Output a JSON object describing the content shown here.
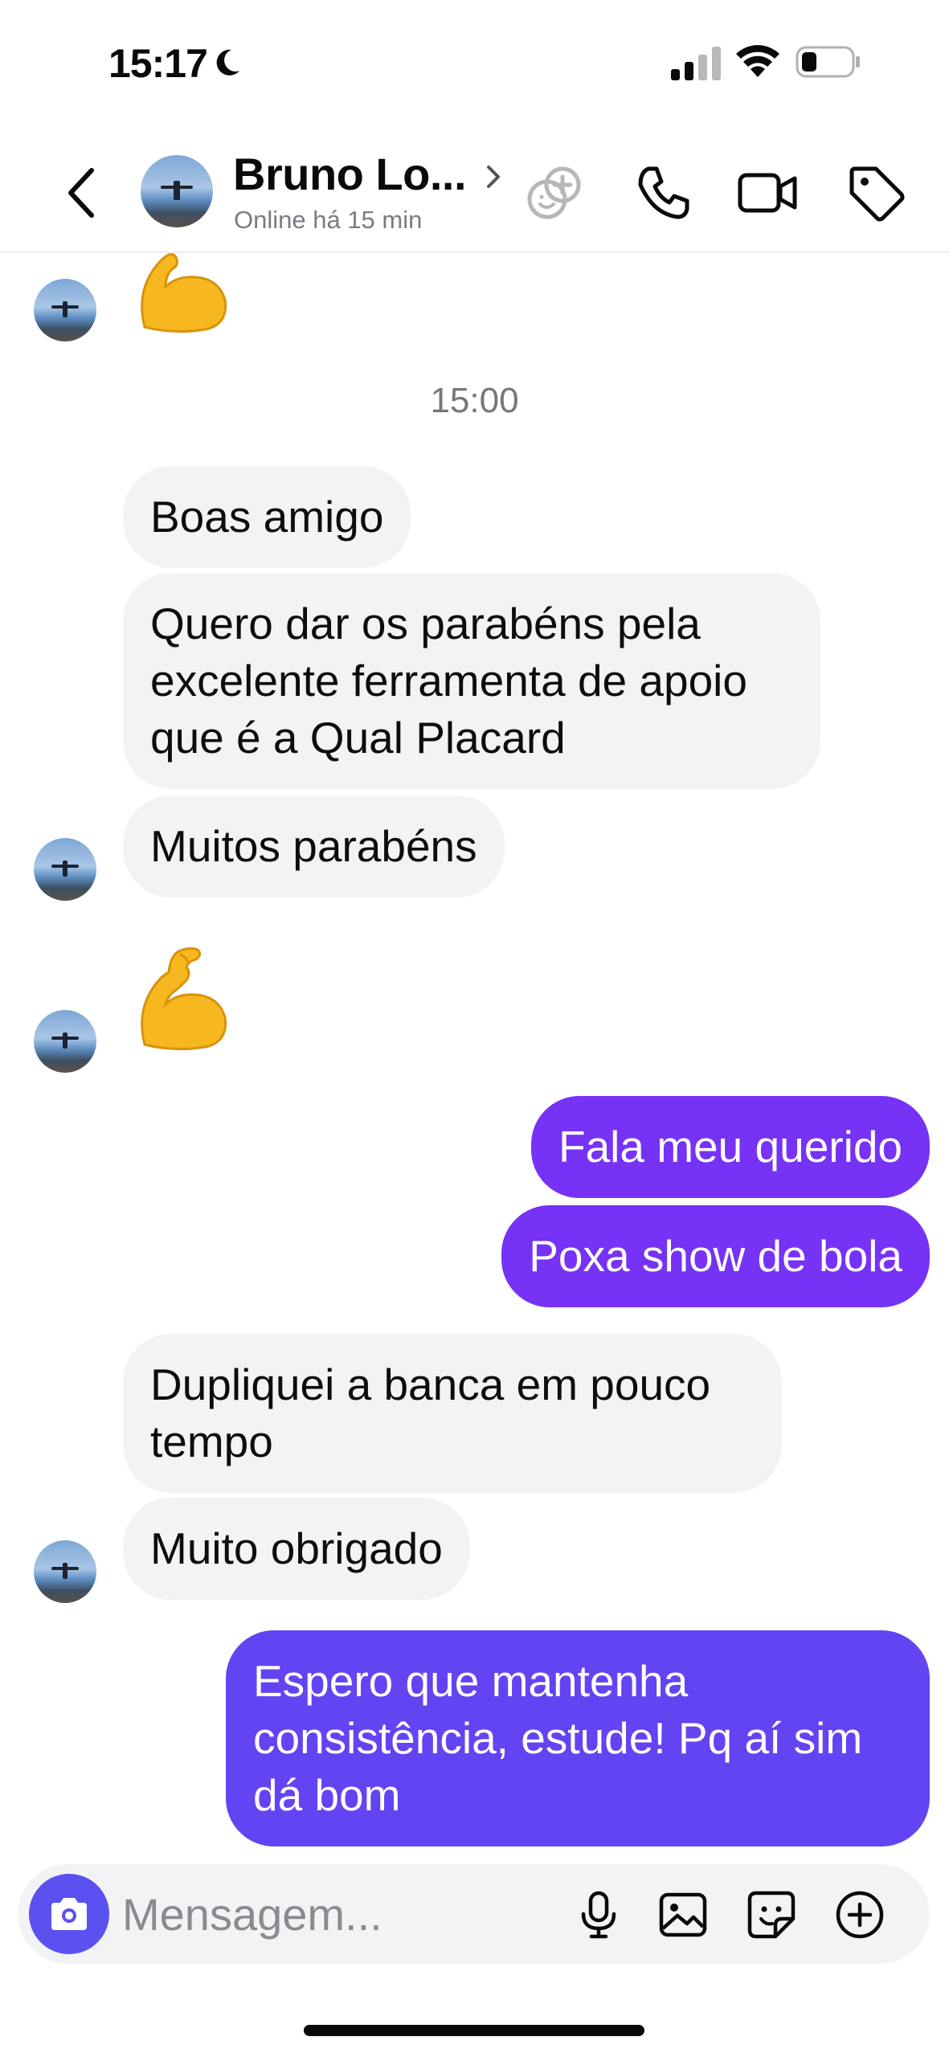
{
  "status_bar": {
    "time": "15:17",
    "icons": [
      "moon-icon",
      "cellular-signal-icon",
      "wifi-icon",
      "battery-icon"
    ]
  },
  "header": {
    "contact_name": "Bruno Lo...",
    "contact_status": "Online há 15 min",
    "icons": [
      "back-icon",
      "chevron-right-icon",
      "reactions-icon",
      "phone-icon",
      "video-camera-icon",
      "tag-icon"
    ]
  },
  "chat": {
    "timestamp": "15:00",
    "emoji_flexed_biceps": "💪",
    "messages": [
      {
        "sender": "contact",
        "text": "Boas amigo"
      },
      {
        "sender": "contact",
        "text": "Quero dar os parabéns pela excelente ferramenta de apoio que é a Qual Placard"
      },
      {
        "sender": "contact",
        "text": "Muitos parabéns"
      },
      {
        "sender": "contact",
        "text": "💪"
      },
      {
        "sender": "me",
        "text": "Fala meu querido"
      },
      {
        "sender": "me",
        "text": "Poxa show de bola"
      },
      {
        "sender": "contact",
        "text": "Dupliquei a banca em pouco tempo"
      },
      {
        "sender": "contact",
        "text": "Muito obrigado"
      },
      {
        "sender": "me",
        "text": "Espero que mantenha consistência, estude! Pq aí sim dá bom"
      }
    ]
  },
  "composer": {
    "placeholder": "Mensagem...",
    "icons": [
      "camera-icon",
      "microphone-icon",
      "gallery-icon",
      "sticker-icon",
      "plus-icon"
    ]
  },
  "colors": {
    "outgoing_bubble": "#7632f5",
    "outgoing_bubble_latest": "#6244f2",
    "incoming_bubble": "#f2f3f5",
    "camera_button": "#5b51f0",
    "secondary_text": "#7b7b82"
  }
}
